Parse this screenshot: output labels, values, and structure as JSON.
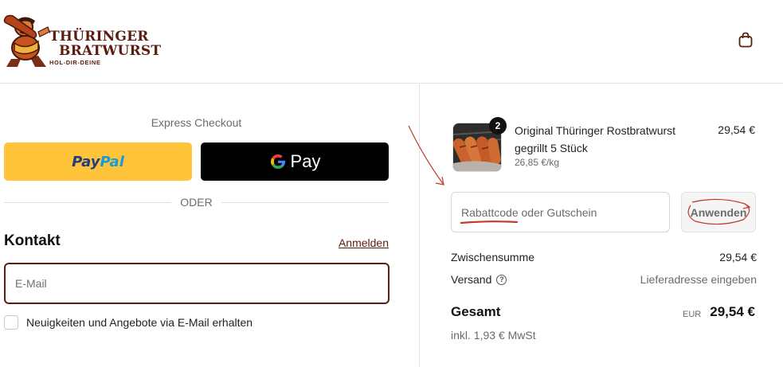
{
  "header": {
    "logo": {
      "line1": "THÜRINGER",
      "line2": "BRATWURST",
      "line3": "HOL-DIR-DEINE"
    },
    "cart_icon": "shopping-bag-icon"
  },
  "express": {
    "label": "Express Checkout",
    "paypal": {
      "pay": "Pay",
      "pal": "Pal"
    },
    "gpay": {
      "g": "G",
      "pay": "Pay"
    },
    "separator": "ODER"
  },
  "contact": {
    "title": "Kontakt",
    "login_link": "Anmelden",
    "email_placeholder": "E-Mail",
    "newsletter_label": "Neuigkeiten und Angebote via E-Mail erhalten"
  },
  "order": {
    "item": {
      "name": "Original Thüringer Rostbratwurst gegrillt 5 Stück",
      "unit_price": "26,85 €/kg",
      "price": "29,54 €",
      "quantity": "2"
    },
    "discount": {
      "placeholder": "Rabattcode oder Gutschein",
      "apply_label": "Anwenden"
    },
    "subtotal": {
      "label": "Zwischensumme",
      "value": "29,54 €"
    },
    "shipping": {
      "label": "Versand",
      "value": "Lieferadresse eingeben"
    },
    "total": {
      "label": "Gesamt",
      "currency": "EUR",
      "value": "29,54 €"
    },
    "tax_note": "inkl. 1,93 € MwSt"
  },
  "colors": {
    "brand": "#5b1d0f",
    "paypal_bg": "#ffc43a",
    "gpay_bg": "#000000",
    "annotation": "#c0392b"
  }
}
